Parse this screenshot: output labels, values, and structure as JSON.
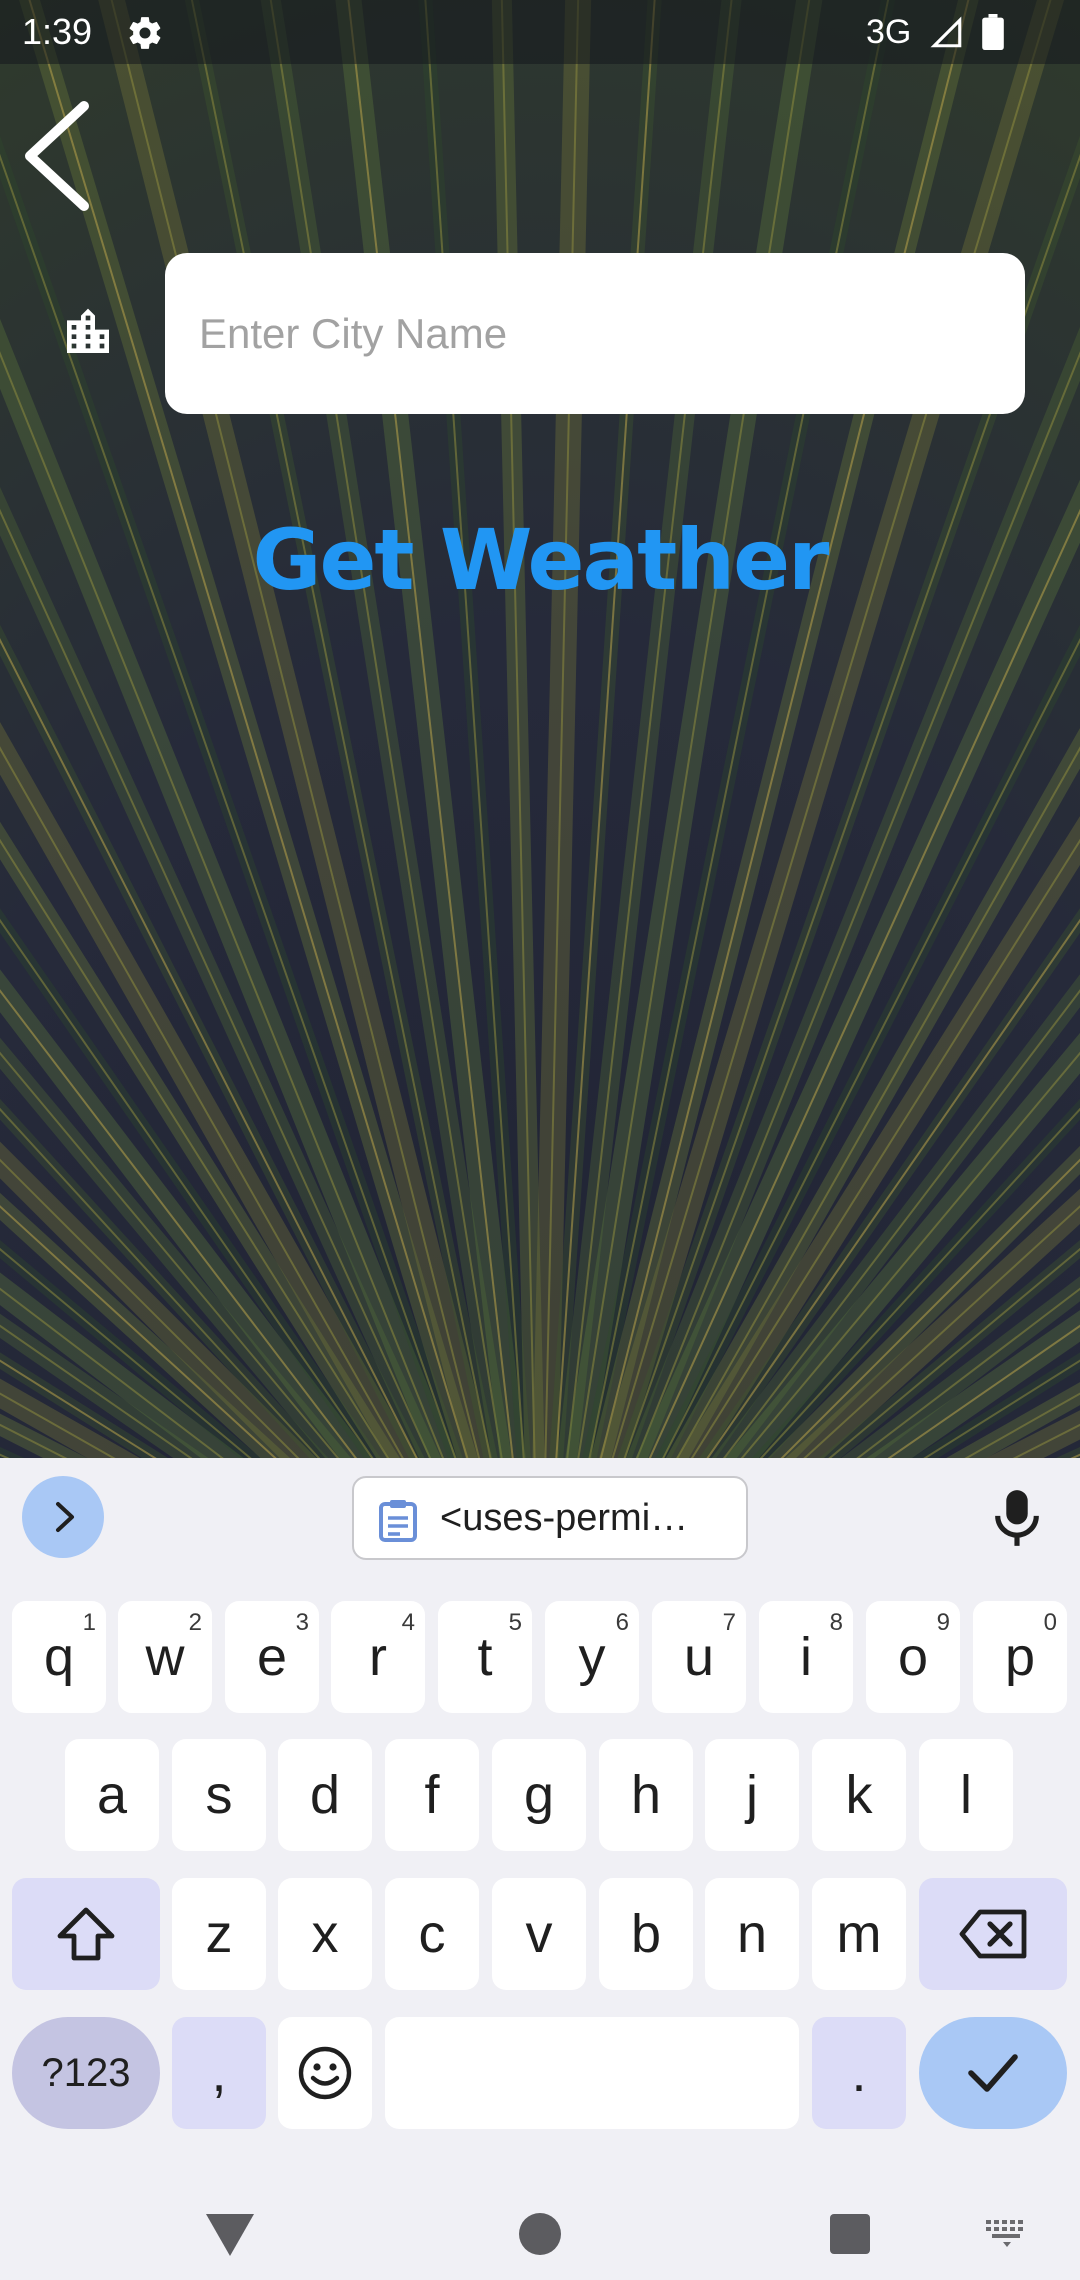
{
  "status_bar": {
    "time": "1:39",
    "network": "3G",
    "icons": [
      "gear-icon",
      "signal-icon",
      "battery-icon"
    ]
  },
  "header": {
    "back_icon": "chevron-left-icon"
  },
  "form": {
    "city_icon": "city-buildings-icon",
    "city_placeholder": "Enter City Name",
    "city_value": "",
    "get_weather_label": "Get Weather"
  },
  "colors": {
    "accent": "#2196f3",
    "input_bg": "#ffffff",
    "keyboard_bg": "#f0f0f5",
    "modifier_key": "#dcdcf7",
    "enter_key": "#a9c8f5"
  },
  "keyboard": {
    "clipboard_suggestion": "<uses-permi…",
    "row1": [
      {
        "key": "q",
        "hint": "1"
      },
      {
        "key": "w",
        "hint": "2"
      },
      {
        "key": "e",
        "hint": "3"
      },
      {
        "key": "r",
        "hint": "4"
      },
      {
        "key": "t",
        "hint": "5"
      },
      {
        "key": "y",
        "hint": "6"
      },
      {
        "key": "u",
        "hint": "7"
      },
      {
        "key": "i",
        "hint": "8"
      },
      {
        "key": "o",
        "hint": "9"
      },
      {
        "key": "p",
        "hint": "0"
      }
    ],
    "row2": [
      "a",
      "s",
      "d",
      "f",
      "g",
      "h",
      "j",
      "k",
      "l"
    ],
    "row3": [
      "z",
      "x",
      "c",
      "v",
      "b",
      "n",
      "m"
    ],
    "symbols_label": "?123",
    "comma_label": ",",
    "period_label": ".",
    "icons": [
      "chevron-right-icon",
      "clipboard-icon",
      "mic-icon",
      "shift-icon",
      "backspace-icon",
      "emoji-icon",
      "checkmark-icon"
    ]
  },
  "nav_bar": {
    "icons": [
      "nav-back-icon",
      "nav-home-icon",
      "nav-recents-icon",
      "keyboard-switch-icon"
    ]
  }
}
